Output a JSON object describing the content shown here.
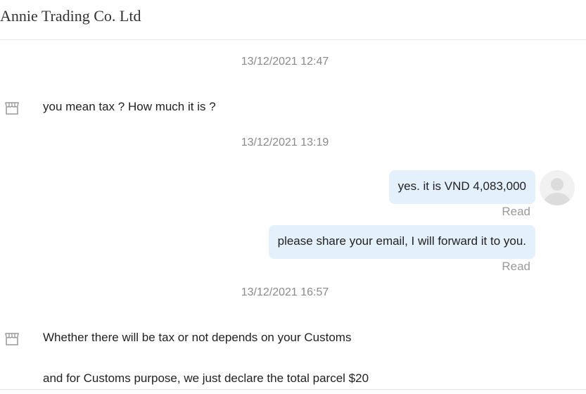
{
  "header": {
    "title": "Annie Trading Co. Ltd"
  },
  "conversation": {
    "timestamps": [
      "13/12/2021 12:47",
      "13/12/2021 13:19",
      "13/12/2021 16:57"
    ],
    "incoming": [
      "you mean tax ?  How much it is ?",
      "Whether there will be tax or not depends on your Customs",
      "and for Customs purpose, we just declare the total parcel $20"
    ],
    "outgoing": [
      {
        "text": "yes. it is VND 4,083,000",
        "status": "Read"
      },
      {
        "text": "please share your email, I will forward it to you.",
        "status": "Read"
      }
    ]
  },
  "icons": {
    "shop_avatar": "shop-icon",
    "user_avatar": "user-avatar-icon"
  },
  "colors": {
    "outgoing_bubble": "#e5f0fd",
    "timestamp": "#8a8a8a",
    "read_status": "#9a9a9a"
  }
}
